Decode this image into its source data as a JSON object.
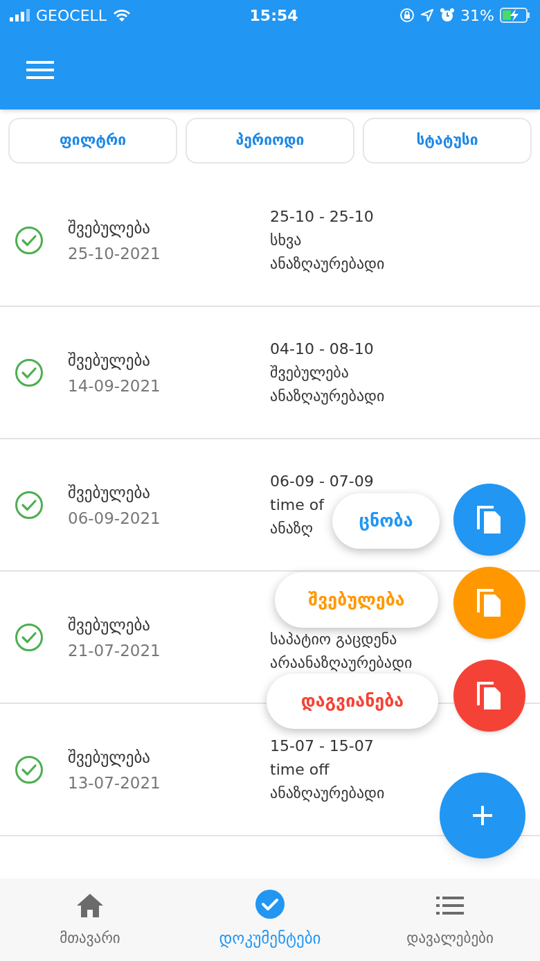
{
  "status_bar": {
    "carrier": "GEOCELL",
    "time": "15:54",
    "battery": "31%"
  },
  "filters": [
    "ფილტრი",
    "პერიოდი",
    "სტატუსი"
  ],
  "documents": [
    {
      "type": "შვებულება",
      "date": "25-10-2021",
      "lines": [
        "25-10 - 25-10",
        "სხვა",
        "ანაზღაურებადი"
      ]
    },
    {
      "type": "შვებულება",
      "date": "14-09-2021",
      "lines": [
        "04-10 - 08-10",
        "შვებულება",
        "ანაზღაურებადი"
      ]
    },
    {
      "type": "შვებულება",
      "date": "06-09-2021",
      "lines": [
        "06-09 - 07-09",
        "time of",
        "ანაზღ"
      ]
    },
    {
      "type": "შვებულება",
      "date": "21-07-2021",
      "lines": [
        "საპატიო გაცდენა",
        "არაანაზღაურებადი"
      ]
    },
    {
      "type": "შვებულება",
      "date": "13-07-2021",
      "lines": [
        "15-07 - 15-07",
        "time off",
        "ანაზღაურებადი"
      ]
    }
  ],
  "fab_menu": [
    {
      "label": "ცნობა",
      "color": "#2196f3"
    },
    {
      "label": "შვებულება",
      "color": "#ff9800"
    },
    {
      "label": "დაგვიანება",
      "color": "#f44336"
    }
  ],
  "nav": [
    {
      "label": "მთავარი",
      "kind": "home",
      "selected": false
    },
    {
      "label": "დოკუმენტები",
      "kind": "check",
      "selected": true
    },
    {
      "label": "დავალებები",
      "kind": "list",
      "selected": false
    }
  ]
}
